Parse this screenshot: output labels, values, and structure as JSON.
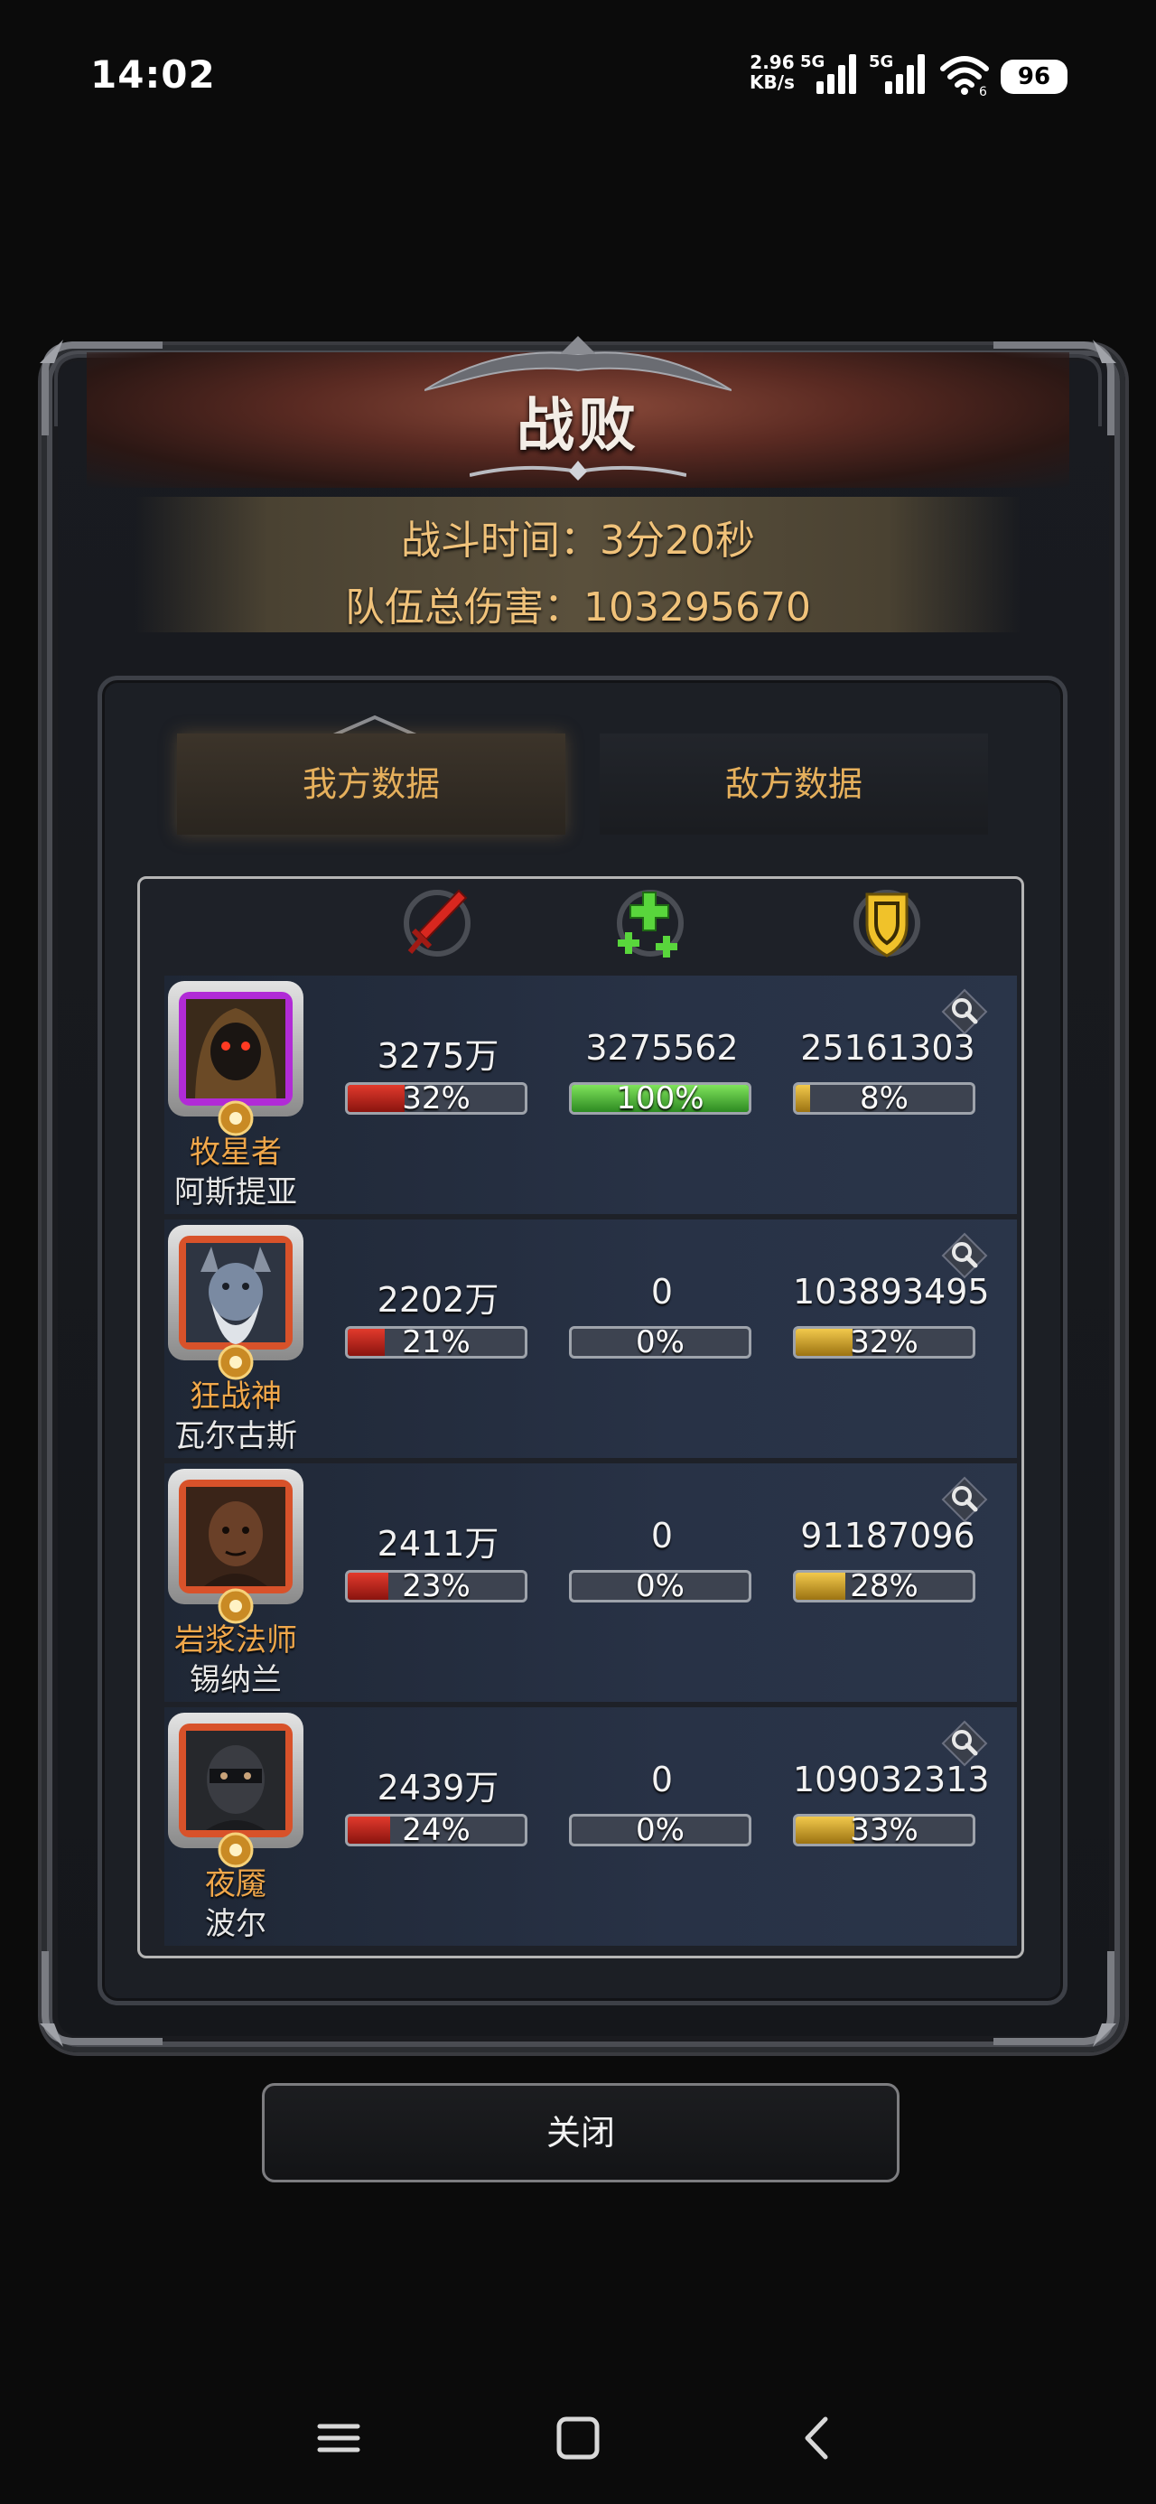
{
  "status_bar": {
    "time": "14:02",
    "net_speed_value": "2.96",
    "net_speed_unit": "KB/s",
    "sim1_label": "5G",
    "sim2_label": "5G",
    "wifi_label": "6",
    "battery": "96"
  },
  "result": {
    "title": "战败",
    "battle_time_label": "战斗时间：",
    "battle_time": "3分20秒",
    "total_damage_label": "队伍总伤害：",
    "total_damage": "103295670"
  },
  "tabs": [
    {
      "label": "我方数据",
      "active": true
    },
    {
      "label": "敌方数据",
      "active": false
    }
  ],
  "column_icons": [
    "sword-icon",
    "heal-cross-icon",
    "shield-icon"
  ],
  "heroes": [
    {
      "title": "牧星者",
      "name": "阿斯提亚",
      "frame": "purple",
      "damage": "3275万",
      "damage_pct": 32,
      "heal": "3275562",
      "heal_pct": 100,
      "taken": "25161303",
      "taken_pct": 8
    },
    {
      "title": "狂战神",
      "name": "瓦尔古斯",
      "frame": "orange",
      "damage": "2202万",
      "damage_pct": 21,
      "heal": "0",
      "heal_pct": 0,
      "taken": "103893495",
      "taken_pct": 32
    },
    {
      "title": "岩浆法师",
      "name": "锡纳兰",
      "frame": "orange",
      "damage": "2411万",
      "damage_pct": 23,
      "heal": "0",
      "heal_pct": 0,
      "taken": "91187096",
      "taken_pct": 28
    },
    {
      "title": "夜魇",
      "name": "波尔",
      "frame": "orange",
      "damage": "2439万",
      "damage_pct": 24,
      "heal": "0",
      "heal_pct": 0,
      "taken": "109032313",
      "taken_pct": 33
    }
  ],
  "close_button": "关闭",
  "colors": {
    "accent_gold": "#f0c27a",
    "title_orange": "#f0a74a",
    "damage_red": "#e23a2c",
    "heal_green": "#7fe35b",
    "taken_gold": "#f2c94c"
  }
}
